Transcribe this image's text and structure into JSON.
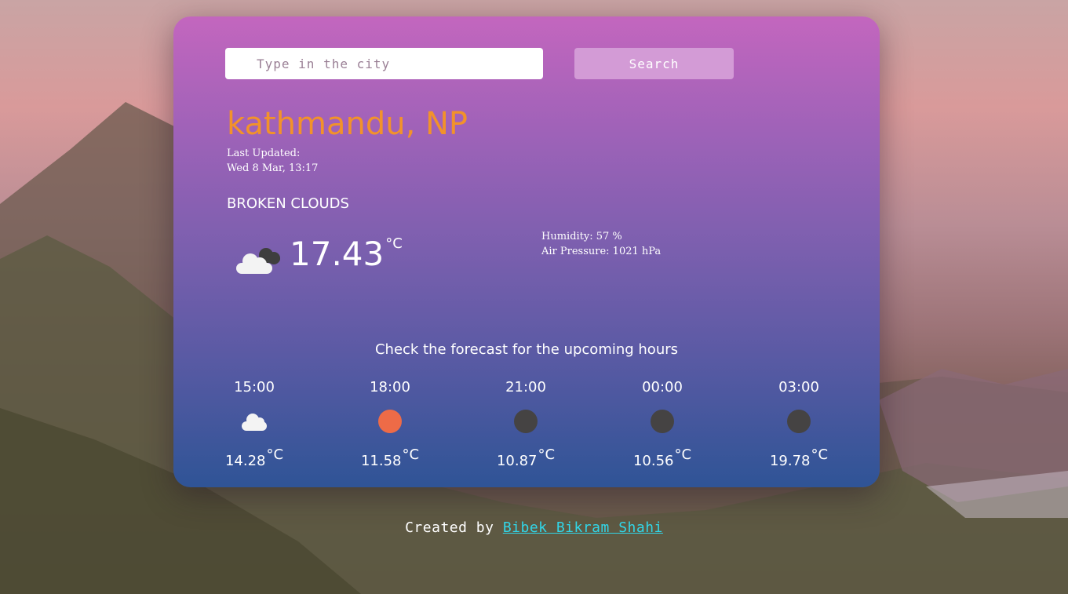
{
  "search": {
    "placeholder": "Type in the city",
    "button_label": "Search"
  },
  "weather": {
    "city": "kathmandu, NP",
    "last_updated_label": "Last Updated:",
    "last_updated_time": "Wed 8 Mar, 13:17",
    "condition": "BROKEN CLOUDS",
    "icon": "broken-clouds-icon",
    "temperature": "17.43",
    "unit": "°C",
    "humidity": "Humidity: 57 %",
    "pressure": "Air Pressure: 1021 hPa"
  },
  "forecast": {
    "title": "Check the forecast for the upcoming hours",
    "items": [
      {
        "time": "15:00",
        "temp": "14.28",
        "unit": "°C",
        "icon": "cloud-icon",
        "color": "#f3f3f3"
      },
      {
        "time": "18:00",
        "temp": "11.58",
        "unit": "°C",
        "icon": "sun-icon",
        "color": "#ee6b47"
      },
      {
        "time": "21:00",
        "temp": "10.87",
        "unit": "°C",
        "icon": "moon-icon",
        "color": "#454343"
      },
      {
        "time": "00:00",
        "temp": "10.56",
        "unit": "°C",
        "icon": "moon-icon",
        "color": "#454343"
      },
      {
        "time": "03:00",
        "temp": "19.78",
        "unit": "°C",
        "icon": "moon-icon",
        "color": "#454343"
      }
    ]
  },
  "footer": {
    "prefix": "Created by ",
    "author": "Bibek Bikram Shahi"
  },
  "colors": {
    "city": "#f2922a",
    "search_button": "#d39bd6",
    "link": "#31d6e8"
  }
}
